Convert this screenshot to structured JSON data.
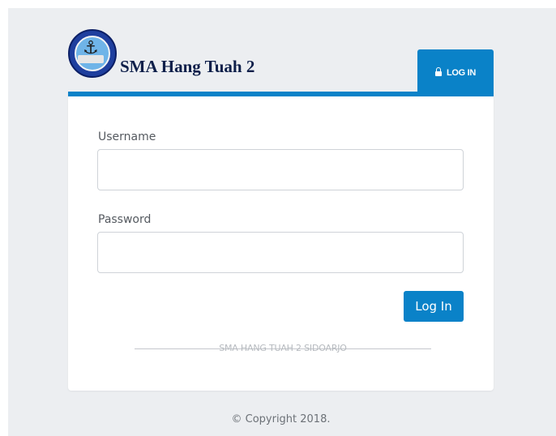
{
  "header": {
    "school_name": "SMA Hang Tuah 2",
    "tab_label": "LOG IN",
    "tab_icon": "lock-icon",
    "logo_icon": "school-emblem-icon"
  },
  "form": {
    "username_label": "Username",
    "username_value": "",
    "password_label": "Password",
    "password_value": "",
    "submit_label": "Log In"
  },
  "card_footer": {
    "text": "SMA HANG TUAH 2 SIDOARJO"
  },
  "page_footer": {
    "copyright": "© Copyright 2018."
  },
  "colors": {
    "accent": "#0a82c8",
    "background": "#eceef1",
    "title": "#0e1f4a"
  }
}
